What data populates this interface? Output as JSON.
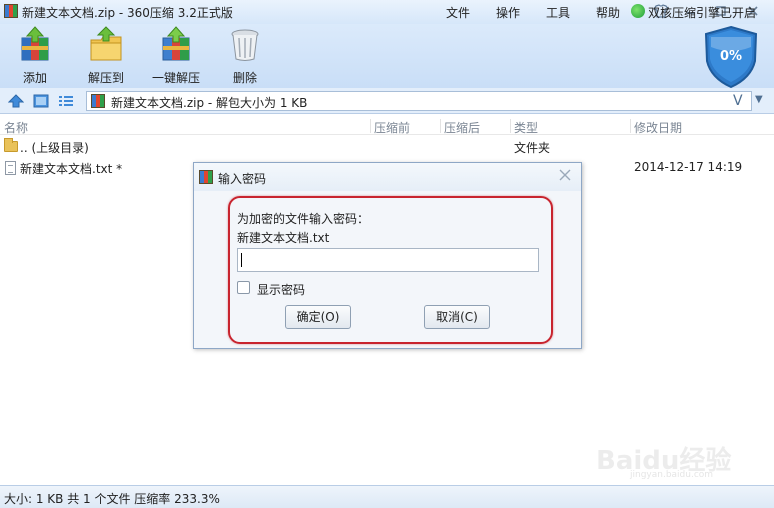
{
  "window": {
    "title": "新建文本文档.zip - 360压缩 3.2正式版",
    "menu": [
      "文件",
      "操作",
      "工具",
      "帮助"
    ]
  },
  "toolbar": {
    "add": "添加",
    "extract_to": "解压到",
    "one_click_extract": "一键解压",
    "delete": "删除",
    "shield_percent": "0%"
  },
  "address": {
    "path": "新建文本文档.zip - 解包大小为 1 KB",
    "v_glyph": "V",
    "drop_glyph": "▼"
  },
  "columns": {
    "name": "名称",
    "compressed_before": "压缩前",
    "compressed_after": "压缩后",
    "type": "类型",
    "modified": "修改日期"
  },
  "files": [
    {
      "name": ".. (上级目录)",
      "type": "文件夹",
      "modified": ""
    },
    {
      "name": "新建文本文档.txt *",
      "type": "",
      "modified": "2014-12-17 14:19"
    }
  ],
  "dialog": {
    "title": "输入密码",
    "prompt": "为加密的文件输入密码：",
    "filename": "新建文本文档.txt",
    "password_value": "",
    "show_password": "显示密码",
    "ok": "确定(O)",
    "cancel": "取消(C)"
  },
  "watermark": {
    "text": "Baidu经验",
    "url": "jingyan.baidu.com"
  },
  "status": {
    "left": "大小: 1 KB 共 1 个文件 压缩率 233.3%",
    "right": "双核压缩引擎已开启"
  },
  "colors": {
    "title_bg": "#d6e7fa",
    "highlight_frame": "#c8242e"
  }
}
